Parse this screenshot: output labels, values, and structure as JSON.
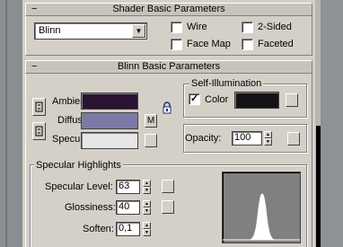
{
  "colors": {
    "panel": "#d4d0c8",
    "ambient_swatch": "#2b1333",
    "diffuse_swatch": "#7c79a8",
    "specular_swatch": "#e6e6e6",
    "self_illum_swatch": "#141414",
    "graph_bg": "#808080",
    "graph_curve": "#ffffff"
  },
  "shader_rollout": {
    "minus": "−",
    "title": "Shader Basic Parameters",
    "shader_dropdown_value": "Blinn",
    "dropdown_arrow": "▼",
    "wire": {
      "label": "Wire",
      "checked": false
    },
    "two_sided": {
      "label": "2-Sided",
      "checked": false
    },
    "face_map": {
      "label": "Face Map",
      "checked": false
    },
    "faceted": {
      "label": "Faceted",
      "checked": false
    }
  },
  "blinn_rollout": {
    "minus": "−",
    "title": "Blinn Basic Parameters",
    "ambient_label": "Ambient:",
    "diffuse_label": "Diffuse:",
    "specular_label": "Specular:",
    "map_button_label": "M",
    "self_illum": {
      "title": "Self-Illumination",
      "color_label": "Color",
      "color_checked": true,
      "check_mark": "✓"
    },
    "opacity": {
      "label": "Opacity:",
      "value": "100"
    }
  },
  "specular_highlights": {
    "title": "Specular Highlights",
    "specular_level": {
      "label": "Specular Level:",
      "value": "63"
    },
    "glossiness": {
      "label": "Glossiness:",
      "value": "40"
    },
    "soften": {
      "label": "Soften:",
      "value": "0,1"
    }
  },
  "icons": {
    "lock": "lock-icon",
    "link": "link-icon",
    "spin_up": "▲",
    "spin_down": "▼"
  }
}
